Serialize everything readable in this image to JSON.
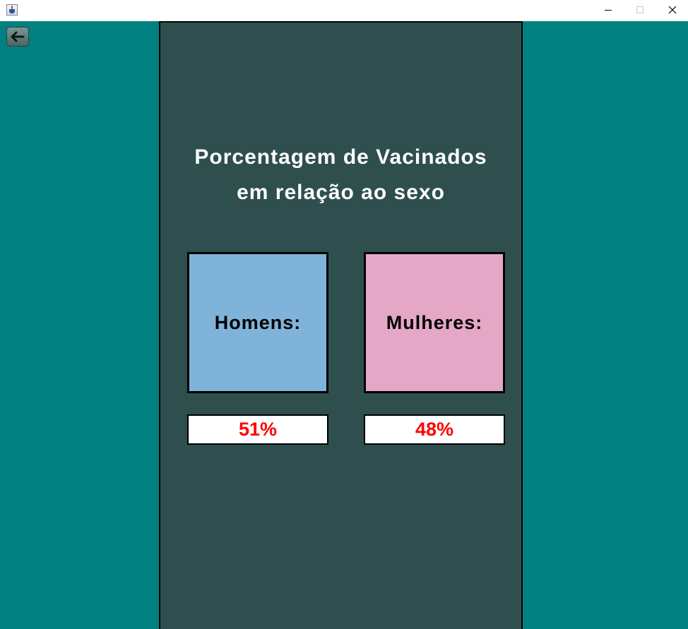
{
  "window": {
    "icon": "java-app-icon",
    "controls": [
      "minimize-icon",
      "maximize-icon",
      "close-icon"
    ]
  },
  "back_button": {
    "icon": "arrow-left-icon"
  },
  "title": {
    "line1": "Porcentagem de Vacinados",
    "line2": "em relação ao sexo"
  },
  "men": {
    "label": "Homens:",
    "percentage": "51%",
    "color": "#80b3d9"
  },
  "women": {
    "label": "Mulheres:",
    "percentage": "48%",
    "color": "#e4a8c6"
  },
  "colors": {
    "background": "#008080",
    "panel": "#2f4f4f",
    "percentage_text": "#ff0000"
  }
}
